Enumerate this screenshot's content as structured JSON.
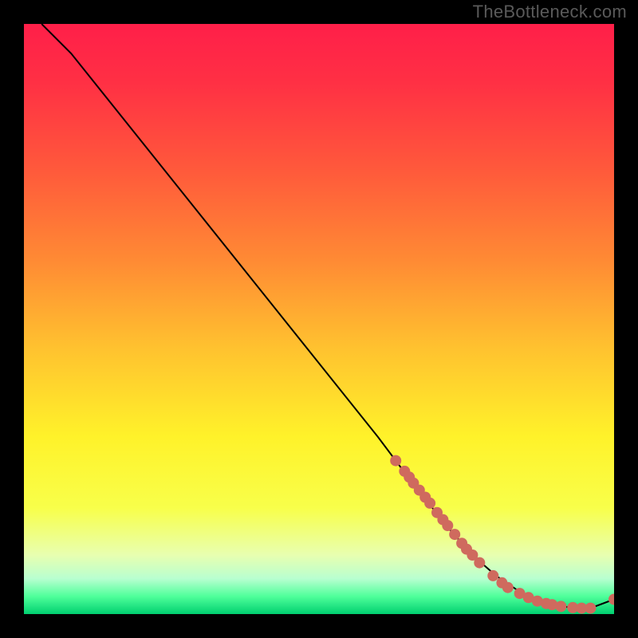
{
  "watermark": "TheBottleneck.com",
  "chart_data": {
    "type": "line",
    "title": "",
    "xlabel": "",
    "ylabel": "",
    "xlim": [
      0,
      100
    ],
    "ylim": [
      0,
      100
    ],
    "line": {
      "x": [
        3,
        8,
        12,
        20,
        30,
        40,
        50,
        60,
        66,
        72,
        76,
        80,
        84,
        88,
        92,
        96,
        100
      ],
      "y": [
        100,
        95,
        90,
        80,
        67.5,
        55,
        42.5,
        30,
        22,
        14.5,
        10,
        6.5,
        3.8,
        2,
        1.2,
        1,
        2.5
      ]
    },
    "markers": {
      "x": [
        63,
        64.5,
        65.3,
        66,
        67,
        68,
        68.8,
        70,
        71,
        71.8,
        73,
        74.2,
        75,
        76,
        77.2,
        79.5,
        81,
        82,
        84,
        85.5,
        87,
        88.5,
        89.5,
        91,
        93,
        94.5,
        96,
        100
      ],
      "y": [
        26,
        24.2,
        23.2,
        22.2,
        21,
        19.8,
        18.8,
        17.2,
        16,
        15,
        13.5,
        12,
        11,
        10,
        8.7,
        6.5,
        5.3,
        4.5,
        3.5,
        2.8,
        2.2,
        1.8,
        1.6,
        1.3,
        1.1,
        1,
        1,
        2.5
      ],
      "color": "#cf6a5e",
      "radius": 7
    },
    "gradient_stops": [
      {
        "offset": 0.0,
        "color": "#ff1f49"
      },
      {
        "offset": 0.1,
        "color": "#ff3044"
      },
      {
        "offset": 0.25,
        "color": "#ff5a3b"
      },
      {
        "offset": 0.4,
        "color": "#ff8a34"
      },
      {
        "offset": 0.55,
        "color": "#ffc22f"
      },
      {
        "offset": 0.7,
        "color": "#fff22a"
      },
      {
        "offset": 0.82,
        "color": "#f8ff4a"
      },
      {
        "offset": 0.9,
        "color": "#e8ffb0"
      },
      {
        "offset": 0.94,
        "color": "#b8ffd0"
      },
      {
        "offset": 0.97,
        "color": "#4fff9a"
      },
      {
        "offset": 1.0,
        "color": "#00d070"
      }
    ]
  }
}
